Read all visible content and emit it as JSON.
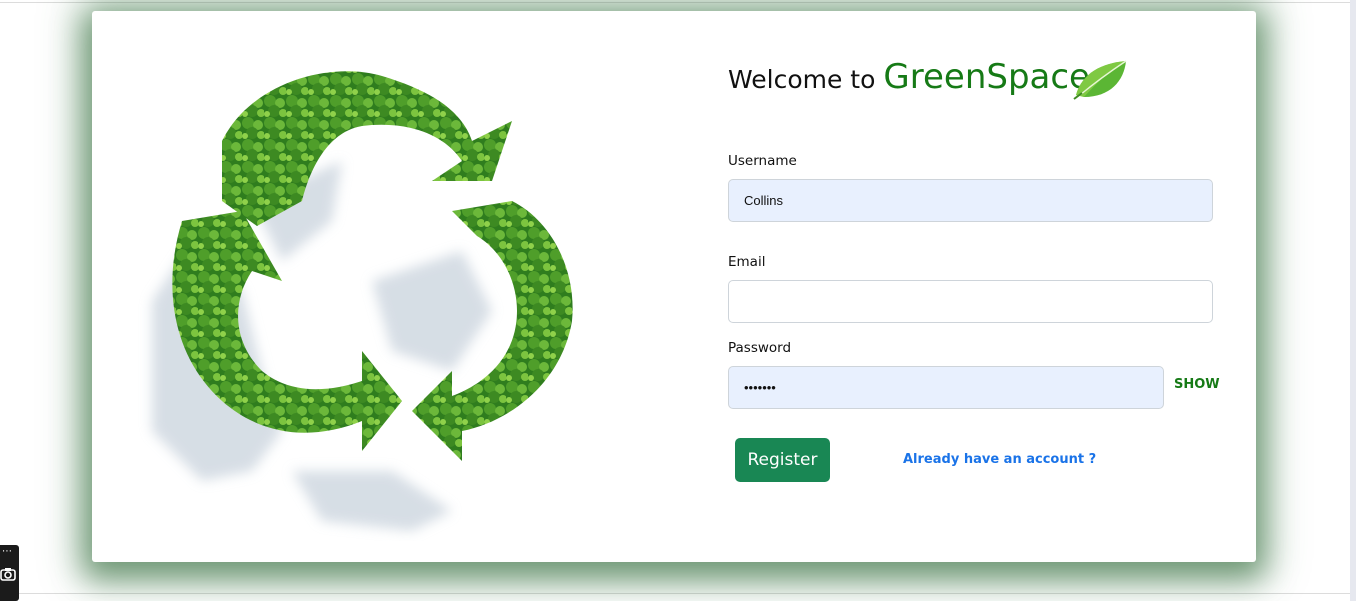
{
  "header": {
    "welcome_prefix": "Welcome to",
    "brand": "GreenSpace"
  },
  "form": {
    "username": {
      "label": "Username",
      "value": "Collins",
      "placeholder": ""
    },
    "email": {
      "label": "Email",
      "value": "",
      "placeholder": ""
    },
    "password": {
      "label": "Password",
      "value": "•••••••",
      "placeholder": ""
    },
    "show_label": "SHOW",
    "register_label": "Register",
    "login_link": "Already have an account ?"
  },
  "icons": {
    "hero": "recycle-trees-illustration",
    "leaf": "leaf-icon",
    "tool": "camera-icon"
  },
  "colors": {
    "brand_green": "#167a16",
    "button_green": "#198754",
    "link_blue": "#1a73e8",
    "autofill_bg": "#e8f0fe"
  }
}
